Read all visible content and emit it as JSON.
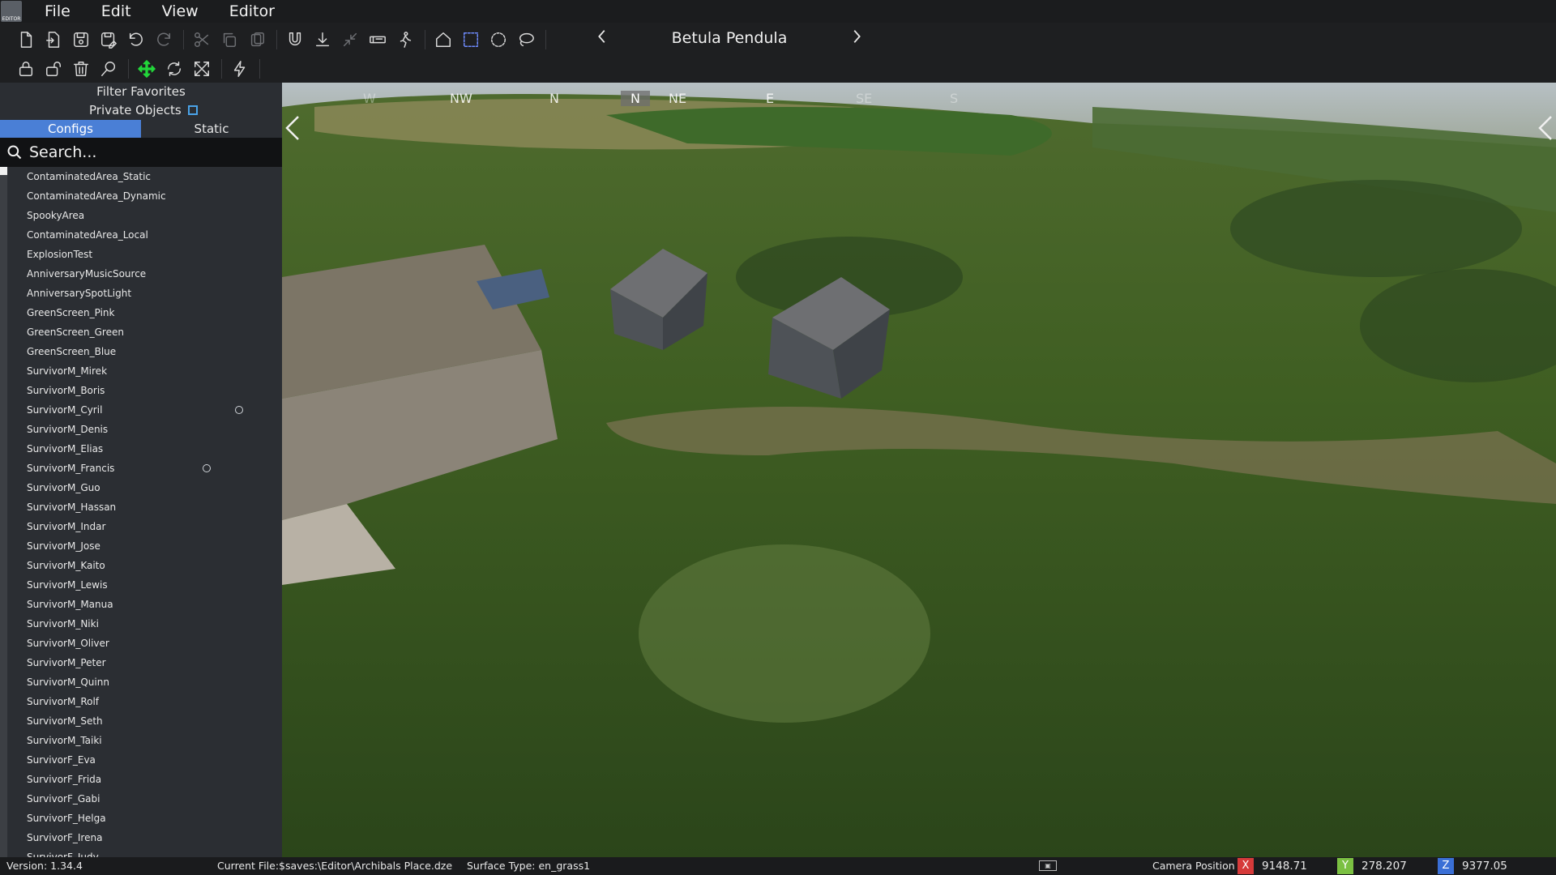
{
  "menubar": {
    "logo_text": "EDITOR",
    "items": [
      "File",
      "Edit",
      "View",
      "Editor"
    ]
  },
  "toolbar": {
    "map_title": "Betula Pendula",
    "row1_icons": [
      "new-file-icon",
      "open-file-icon",
      "save-icon",
      "save-as-icon",
      "undo-icon",
      "redo-icon",
      "cut-icon",
      "copy-icon",
      "paste-icon",
      "magnet-icon",
      "ground-snap-icon",
      "collapse-icon",
      "place-object-icon",
      "walk-mode-icon",
      "home-icon",
      "box-select-icon",
      "circle-select-icon",
      "lasso-select-icon"
    ],
    "row2_icons": [
      "lock-icon",
      "unlock-icon",
      "delete-icon",
      "search-object-icon",
      "move-gizmo-icon",
      "rotate-gizmo-icon",
      "scale-gizmo-icon",
      "lightning-icon"
    ]
  },
  "sidebar": {
    "filter_favorites": "Filter Favorites",
    "private_objects": "Private Objects",
    "tabs": [
      "Configs",
      "Static"
    ],
    "search_placeholder": "Search...",
    "items": [
      "ContaminatedArea_Static",
      "ContaminatedArea_Dynamic",
      "SpookyArea",
      "ContaminatedArea_Local",
      "ExplosionTest",
      "AnniversaryMusicSource",
      "AnniversarySpotLight",
      "GreenScreen_Pink",
      "GreenScreen_Green",
      "GreenScreen_Blue",
      "SurvivorM_Mirek",
      "SurvivorM_Boris",
      "SurvivorM_Cyril",
      "SurvivorM_Denis",
      "SurvivorM_Elias",
      "SurvivorM_Francis",
      "SurvivorM_Guo",
      "SurvivorM_Hassan",
      "SurvivorM_Indar",
      "SurvivorM_Jose",
      "SurvivorM_Kaito",
      "SurvivorM_Lewis",
      "SurvivorM_Manua",
      "SurvivorM_Niki",
      "SurvivorM_Oliver",
      "SurvivorM_Peter",
      "SurvivorM_Quinn",
      "SurvivorM_Rolf",
      "SurvivorM_Seth",
      "SurvivorM_Taiki",
      "SurvivorF_Eva",
      "SurvivorF_Frida",
      "SurvivorF_Gabi",
      "SurvivorF_Helga",
      "SurvivorF_Irena",
      "SurvivorF_Judy"
    ]
  },
  "viewport": {
    "compass": [
      "W",
      "NW",
      "N",
      "N",
      "NE",
      "E",
      "SE",
      "S"
    ]
  },
  "status": {
    "version": "Version:  1.34.4",
    "current_file": "Current File:$saves:\\Editor\\Archibals Place.dze",
    "surface_type": "Surface Type: en_grass1",
    "camera_label": "Camera Position",
    "x_label": "X",
    "x_value": "9148.71",
    "y_label": "Y",
    "y_value": "278.207",
    "z_label": "Z",
    "z_value": "9377.05"
  }
}
